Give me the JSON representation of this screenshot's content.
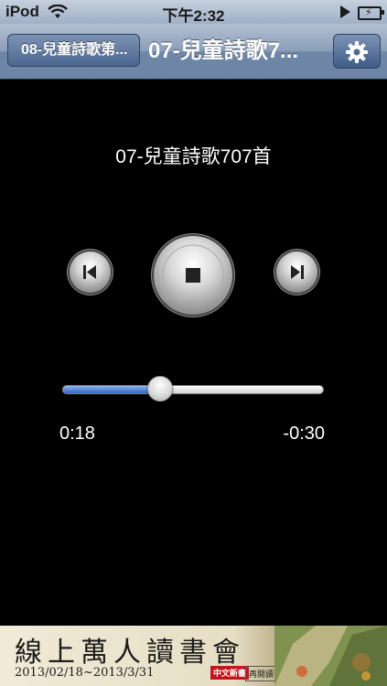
{
  "status_bar": {
    "carrier": "iPod",
    "time": "下午2:32",
    "icons": [
      "wifi-icon",
      "play-icon",
      "battery-charging-icon"
    ]
  },
  "nav_bar": {
    "back_label": "08-兒童詩歌第...",
    "title": "07-兒童詩歌7...",
    "settings_icon": "gear-icon"
  },
  "player": {
    "track_title": "07-兒童詩歌707首",
    "prev_icon": "skip-back-icon",
    "stop_icon": "stop-icon",
    "next_icon": "skip-forward-icon",
    "progress_fraction": 0.375,
    "elapsed": "0:18",
    "remaining": "-0:30"
  },
  "ad_banner": {
    "title": "線上萬人讀書會",
    "dates": "2013/02/18~2013/3/31",
    "logo_1": "中文新書",
    "logo_2": "再閱讀書"
  },
  "colors": {
    "accent": "#2c63c8",
    "navbar": "#6f86a6",
    "background": "#000000"
  }
}
